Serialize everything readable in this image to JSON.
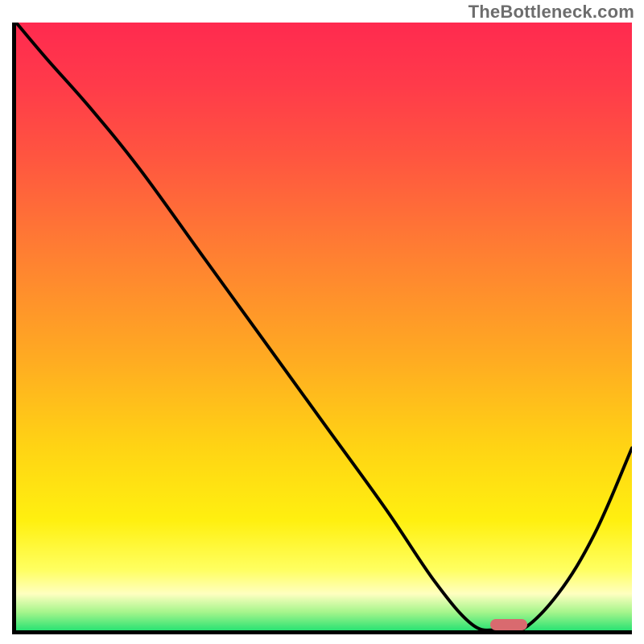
{
  "watermark": "TheBottleneck.com",
  "chart_data": {
    "type": "line",
    "title": "",
    "xlabel": "",
    "ylabel": "",
    "xlim": [
      0,
      100
    ],
    "ylim": [
      0,
      100
    ],
    "grid": false,
    "legend": false,
    "background": {
      "type": "vertical-gradient",
      "description": "bottleneck severity heat gradient, red (top) through orange/yellow to green (bottom)",
      "stops": [
        {
          "pct": 0,
          "color": "#ff2a4f"
        },
        {
          "pct": 22,
          "color": "#ff5540"
        },
        {
          "pct": 55,
          "color": "#ffaa22"
        },
        {
          "pct": 82,
          "color": "#fff010"
        },
        {
          "pct": 94,
          "color": "#ffffc0"
        },
        {
          "pct": 100,
          "color": "#2ae273"
        }
      ]
    },
    "series": [
      {
        "name": "bottleneck-curve",
        "color": "#000000",
        "x": [
          0,
          5,
          12,
          20,
          30,
          40,
          50,
          60,
          68,
          74,
          78,
          82,
          88,
          94,
          100
        ],
        "values": [
          100,
          94,
          86,
          76,
          62,
          48,
          34,
          20,
          8,
          1,
          0,
          0,
          6,
          16,
          30
        ]
      }
    ],
    "marker": {
      "name": "optimal-range-marker",
      "x_center": 80,
      "y": 0.5,
      "color": "#d96a6f",
      "shape": "rounded-bar"
    }
  }
}
